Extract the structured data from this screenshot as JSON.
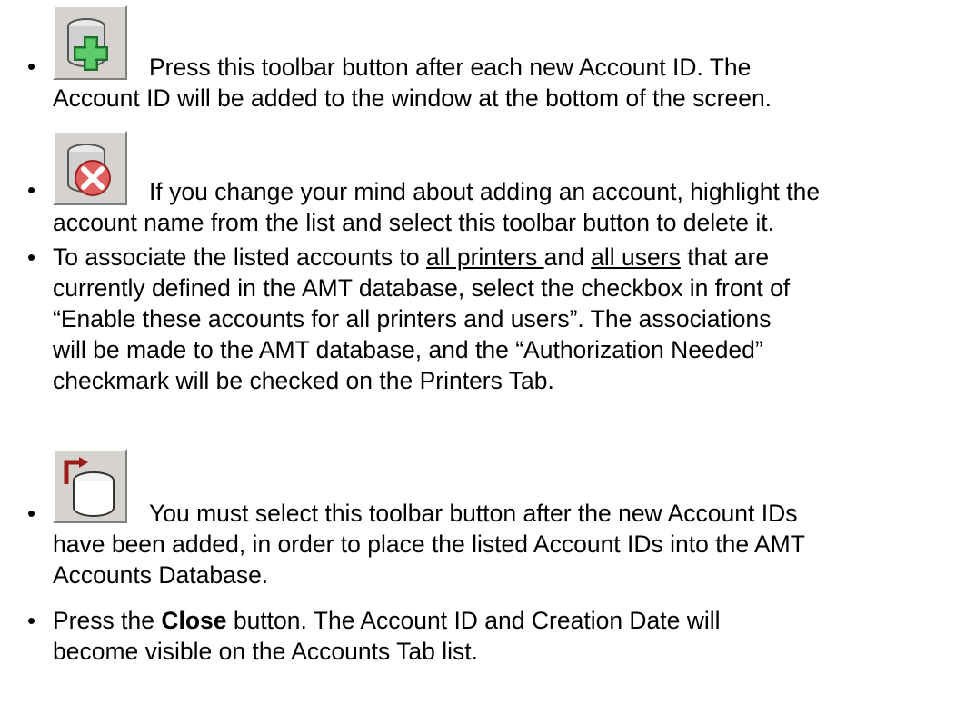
{
  "bullet_char": "•",
  "items": [
    {
      "icon": "database-add-icon",
      "line1": "Press this toolbar button after each new Account ID. The",
      "line2": "Account ID will be added to the window at the bottom of the screen."
    },
    {
      "icon": "database-delete-icon",
      "line1": "If you change your mind about adding an account, highlight the",
      "line2": "account name from the list and select this toolbar button to delete it."
    },
    {
      "text_a": "To associate the listed accounts to ",
      "link1": "all printers ",
      "text_b": "and ",
      "link2": "all users",
      "text_c": " that are",
      "line2": "currently defined in the AMT database, select the checkbox in front of",
      "line3": "“Enable these accounts for all printers and users”. The associations",
      "line4": "will be made to the AMT database, and the “Authorization Needed”",
      "line5": "checkmark will be checked on the Printers Tab."
    },
    {
      "icon": "database-export-icon",
      "line1": "You must select this toolbar button after the new Account IDs",
      "line2": "have been added, in order to place the listed Account IDs into the AMT",
      "line3": "Accounts Database."
    },
    {
      "text_a": "Press the ",
      "bold": "Close",
      "text_b": " button. The Account ID and Creation Date will",
      "line2": "become visible on the Accounts Tab list."
    }
  ]
}
